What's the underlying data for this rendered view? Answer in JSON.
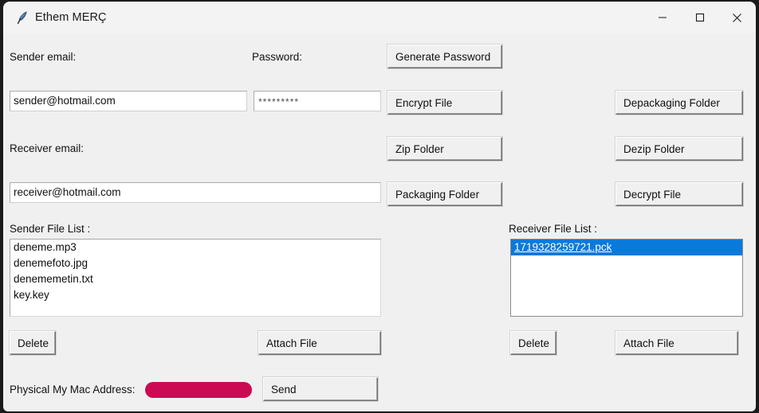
{
  "window": {
    "title": "Ethem MERÇ",
    "icon": "feather-quill-icon",
    "controls": {
      "minimize": "minimize-icon",
      "maximize": "maximize-icon",
      "close": "close-icon"
    },
    "background_color": "#f0f0f0",
    "titlebar_color": "#f3f3f3"
  },
  "form": {
    "sender_email_label": "Sender email:",
    "sender_email_value": "sender@hotmail.com",
    "password_label": "Password:",
    "password_value": "*********",
    "receiver_email_label": "Receiver email:",
    "receiver_email_value": "receiver@hotmail.com"
  },
  "actions": {
    "generate_password": "Generate Password",
    "encrypt_file": "Encrypt File",
    "zip_folder": "Zip Folder",
    "packaging_folder": "Packaging Folder",
    "depackaging_folder": "Depackaging Folder",
    "dezip_folder": "Dezip Folder",
    "decrypt_file": "Decrypt File",
    "send": "Send"
  },
  "sender_panel": {
    "label": "Sender File List :",
    "files": [
      "deneme.mp3",
      "denemefoto.jpg",
      "denememetin.txt",
      "key.key"
    ],
    "delete_label": "Delete",
    "attach_label": "Attach File"
  },
  "receiver_panel": {
    "label": "Receiver File List :",
    "files": [
      "1719328259721.pck"
    ],
    "selected_index": 0,
    "selection_color": "#0a7ada",
    "delete_label": "Delete",
    "attach_label": "Attach File"
  },
  "footer": {
    "mac_label": "Physical My Mac Address:",
    "mac_value_redacted": true,
    "mac_redaction_color": "#cc0a53"
  }
}
